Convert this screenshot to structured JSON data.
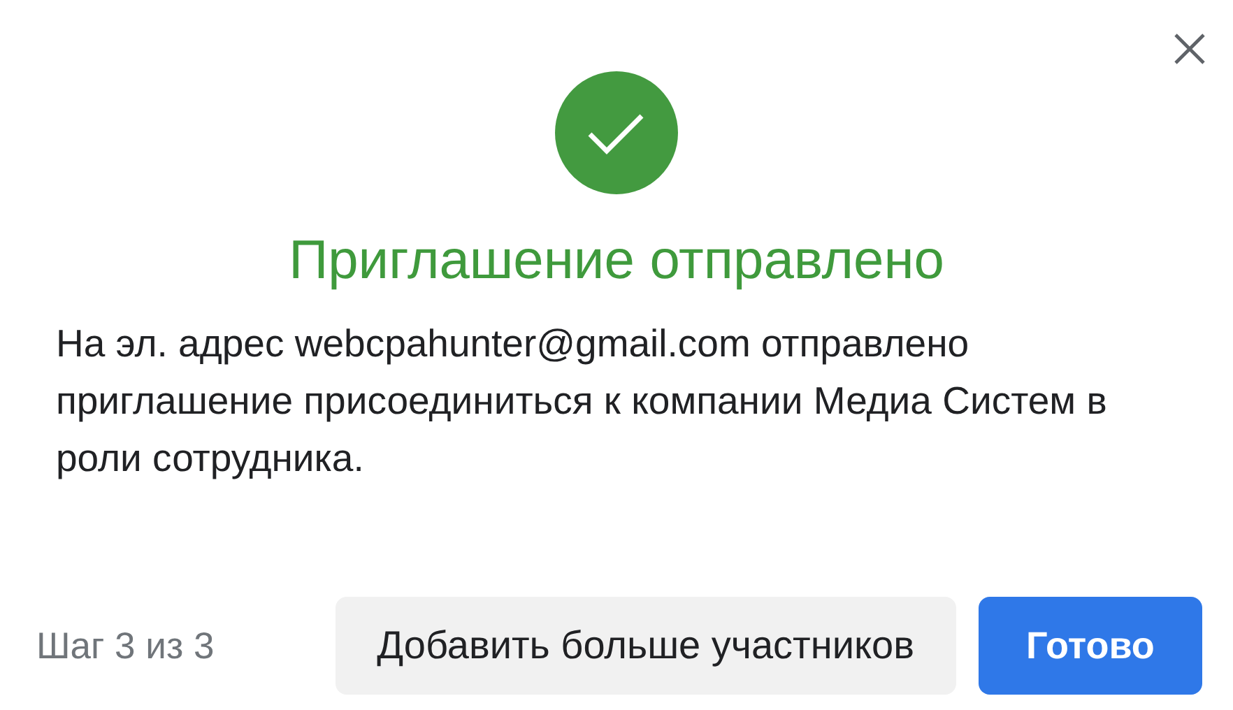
{
  "dialog": {
    "title": "Приглашение отправлено",
    "message": "На эл. адрес webcpahunter@gmail.com отправлено приглашение присоединиться к компании Медиа Систем в роли сотрудника.",
    "step": "Шаг 3 из 3",
    "buttons": [
      {
        "label": "Добавить больше участников",
        "kind": "secondary"
      },
      {
        "label": "Готово",
        "kind": "primary"
      }
    ]
  }
}
